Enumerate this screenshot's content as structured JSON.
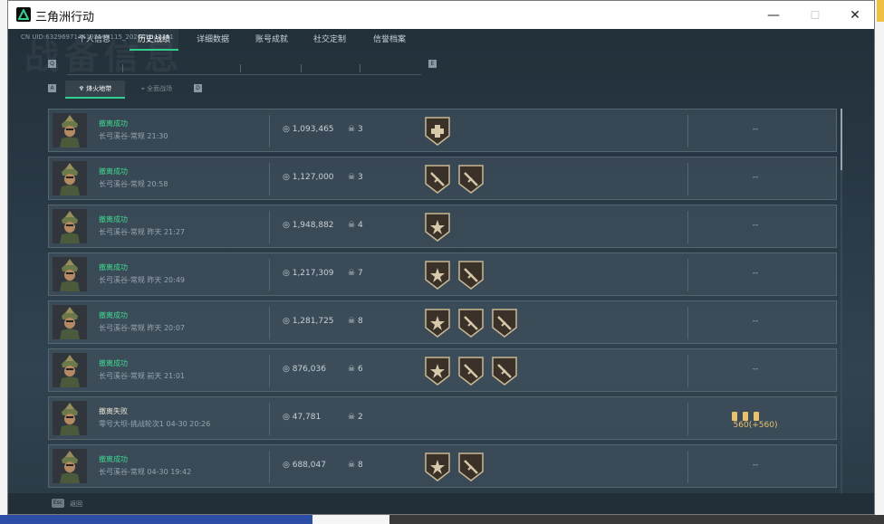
{
  "window": {
    "title": "三角洲行动",
    "min_glyph": "—",
    "max_glyph": "☐",
    "close_glyph": "✕"
  },
  "uid_text": "CN UID:6329697146195568115_202605042351",
  "bg_title": "战备信息",
  "tabs": {
    "left_arrow": "Q",
    "right_arrow": "E",
    "items": [
      {
        "label": "个人信息",
        "active": false
      },
      {
        "label": "历史战绩",
        "active": true
      },
      {
        "label": "详细数据",
        "active": false
      },
      {
        "label": "账号成就",
        "active": false
      },
      {
        "label": "社交定制",
        "active": false
      },
      {
        "label": "信誉档案",
        "active": false
      }
    ]
  },
  "subtabs": {
    "left_arrow": "A",
    "right_arrow": "D",
    "items": [
      {
        "label": "烽火地带",
        "icon": "flame-icon",
        "active": true
      },
      {
        "label": "全面战场",
        "icon": "crosshair-icon",
        "active": false
      }
    ]
  },
  "rows": [
    {
      "result": "撤离成功",
      "success": true,
      "info": "长弓溪谷-常规 21:30",
      "money": "1,093,465",
      "kills": "3",
      "badges": [
        "medic"
      ],
      "reward": "--"
    },
    {
      "result": "撤离成功",
      "success": true,
      "info": "长弓溪谷-常规 20:58",
      "money": "1,127,000",
      "kills": "3",
      "badges": [
        "rifle",
        "rifle"
      ],
      "reward": "--"
    },
    {
      "result": "撤离成功",
      "success": true,
      "info": "长弓溪谷-常规 昨天 21:27",
      "money": "1,948,882",
      "kills": "4",
      "badges": [
        "star"
      ],
      "reward": "--"
    },
    {
      "result": "撤离成功",
      "success": true,
      "info": "长弓溪谷-常规 昨天 20:49",
      "money": "1,217,309",
      "kills": "7",
      "badges": [
        "star",
        "rifle"
      ],
      "reward": "--"
    },
    {
      "result": "撤离成功",
      "success": true,
      "info": "长弓溪谷-常规 昨天 20:07",
      "money": "1,281,725",
      "kills": "8",
      "badges": [
        "star",
        "rifle",
        "rifle"
      ],
      "reward": "--"
    },
    {
      "result": "撤离成功",
      "success": true,
      "info": "长弓溪谷-常规 前天 21:01",
      "money": "876,036",
      "kills": "6",
      "badges": [
        "star",
        "rifle",
        "rifle"
      ],
      "reward": "--"
    },
    {
      "result": "撤离失败",
      "success": false,
      "info": "零号大坝-挑战轮次1 04-30 20:26",
      "money": "47,781",
      "kills": "2",
      "badges": [],
      "reward": "560(+560)"
    },
    {
      "result": "撤离成功",
      "success": true,
      "info": "长弓溪谷-常规 04-30 19:42",
      "money": "688,047",
      "kills": "8",
      "badges": [
        "star",
        "rifle"
      ],
      "reward": "--"
    }
  ],
  "footer": {
    "esc_key": "Esc",
    "esc_label": "返回"
  },
  "colors": {
    "success": "#3fd98f",
    "accent": "#2fcf8e",
    "gold": "#e8c16a"
  }
}
